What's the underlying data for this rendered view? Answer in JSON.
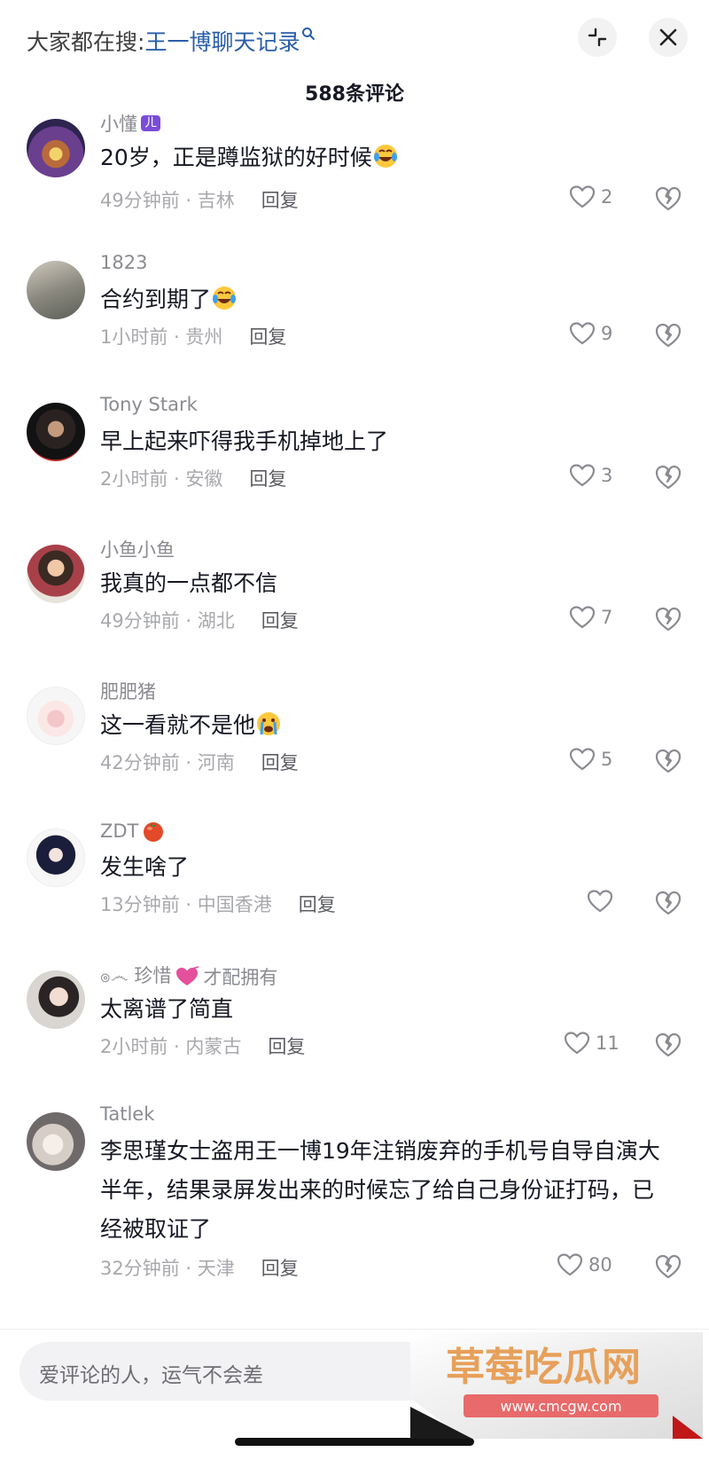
{
  "header": {
    "search_prefix": "大家都在搜:",
    "search_query": "王一博聊天记录",
    "comment_count": "588条评论"
  },
  "comments": [
    {
      "username": "小懂",
      "badge": "ㄦ",
      "text": "20岁，正是蹲监狱的好时候",
      "emoji": "laugh-cry",
      "time_location": "49分钟前 · 吉林",
      "reply": "回复",
      "likes": "2"
    },
    {
      "username": "1823",
      "text": "合约到期了",
      "emoji": "laugh-cry",
      "time_location": "1小时前 · 贵州",
      "reply": "回复",
      "likes": "9"
    },
    {
      "username": "Tony Stark",
      "text": "早上起来吓得我手机掉地上了",
      "time_location": "2小时前 · 安徽",
      "reply": "回复",
      "likes": "3"
    },
    {
      "username": "小鱼小鱼",
      "text": "我真的一点都不信",
      "time_location": "49分钟前 · 湖北",
      "reply": "回复",
      "likes": "7"
    },
    {
      "username": "肥肥猪",
      "text": "这一看就不是他",
      "emoji": "crying-face",
      "time_location": "42分钟前 · 河南",
      "reply": "回复",
      "likes": "5"
    },
    {
      "username": "ZDT",
      "name_emoji": "tomato",
      "text": "发生啥了",
      "time_location": "13分钟前 · 中国香港",
      "reply": "回复",
      "likes": ""
    },
    {
      "username": "ၜ෴ 珍惜",
      "name_suffix": "才配拥有",
      "name_emoji": "heart",
      "text": "太离谱了简直",
      "time_location": "2小时前 · 内蒙古",
      "reply": "回复",
      "likes": "11"
    },
    {
      "username": "Tatlek",
      "text": "李思瑾女士盗用王一博19年注销废弃的手机号自导自演大半年，结果录屏发出来的时候忘了给自己身份证打码，已经被取证了",
      "time_location": "32分钟前 · 天津",
      "reply": "回复",
      "likes": "80"
    }
  ],
  "input": {
    "placeholder": "爱评论的人，运气不会差"
  },
  "watermark": {
    "title": "草莓吃瓜网",
    "url": "www.cmcgw.com"
  },
  "colors": {
    "link": "#2a5ea8",
    "badge": "#7b4cd9",
    "watermark_text": "#e86a6a"
  }
}
